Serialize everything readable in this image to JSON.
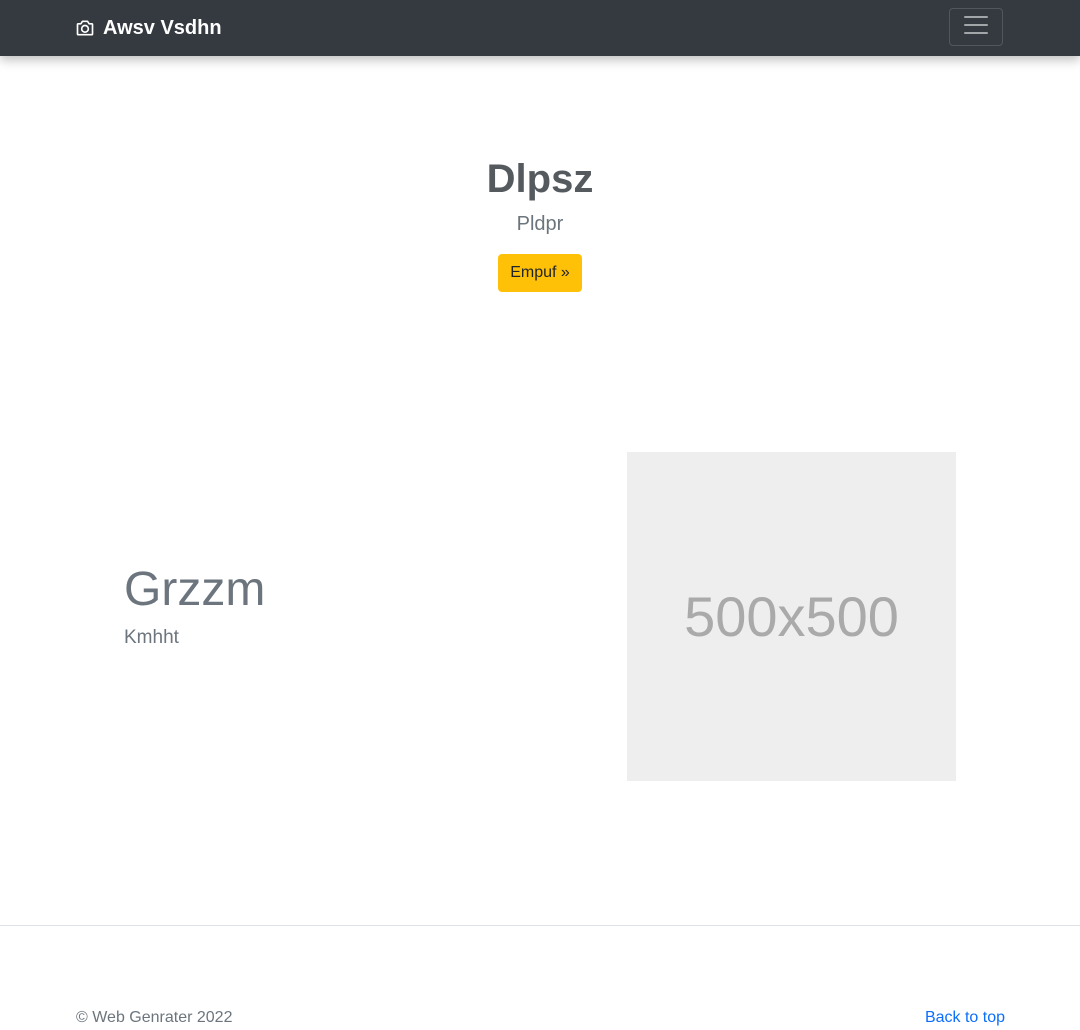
{
  "navbar": {
    "brand_label": "Awsv Vsdhn",
    "brand_icon": "camera-icon",
    "toggler_icon": "hamburger-menu-icon",
    "background": "#343a40"
  },
  "hero": {
    "title": "Dlpsz",
    "subtitle": "Pldpr",
    "button_label": "Empuf »",
    "button_color": "#ffc107"
  },
  "feature": {
    "title": "Grzzm",
    "subtitle": "Kmhht",
    "image_placeholder": "500x500"
  },
  "footer": {
    "copyright": "© Web Genrater 2022",
    "back_to_top": "Back to top",
    "link_color": "#0d6efd"
  }
}
